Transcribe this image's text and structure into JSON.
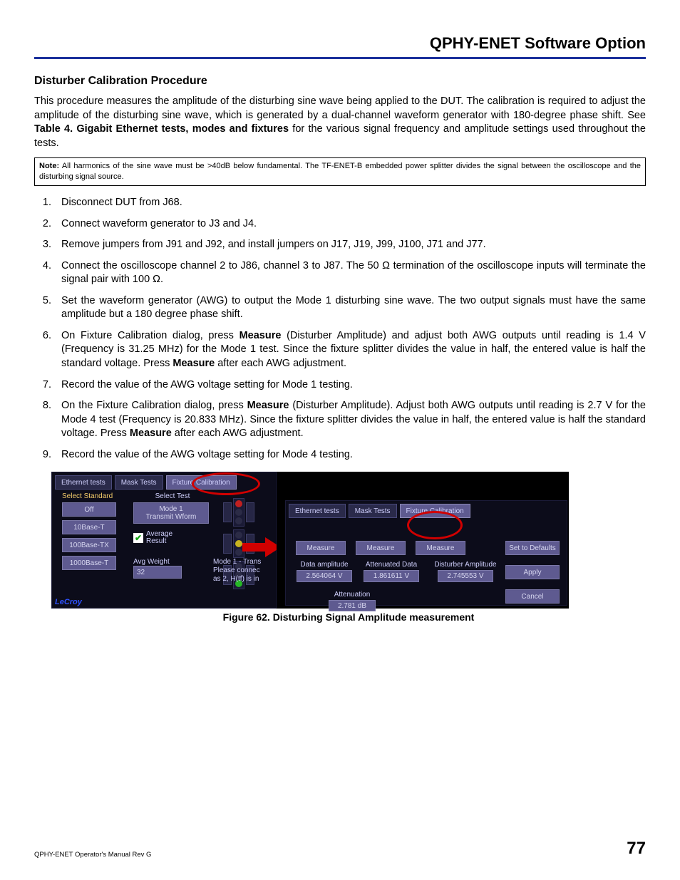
{
  "header": {
    "title": "QPHY-ENET Software Option"
  },
  "section": {
    "title": "Disturber Calibration Procedure"
  },
  "intro": {
    "p1a": "This procedure measures the amplitude of the disturbing sine wave being applied to the DUT. The calibration is required to adjust the amplitude of the disturbing sine wave, which is generated by a dual-channel waveform generator with 180-degree phase shift. See ",
    "p1b": "Table 4. Gigabit Ethernet tests, modes and fixtures",
    "p1c": " for the various signal frequency and amplitude settings used throughout the tests."
  },
  "note": {
    "label": "Note:",
    "text": " All harmonics of the sine wave must be >40dB below fundamental. The TF-ENET-B embedded power splitter divides the signal between the oscilloscope and the disturbing signal source."
  },
  "steps": {
    "s1": "Disconnect DUT from J68.",
    "s2": "Connect waveform generator to J3 and J4.",
    "s3": "Remove jumpers from J91 and J92, and install jumpers on J17, J19, J99, J100, J71 and J77.",
    "s4": "Connect the oscilloscope channel 2 to J86, channel 3 to J87. The 50 Ω termination of the oscilloscope inputs will terminate the signal pair with 100 Ω.",
    "s5": "Set the waveform generator (AWG) to output the Mode 1 disturbing sine wave. The two output signals must have the same amplitude but a 180 degree phase shift.",
    "s6a": "On Fixture Calibration dialog, press ",
    "s6b": "Measure",
    "s6c": " (Disturber Amplitude) and adjust both AWG outputs until reading is 1.4 V (Frequency is 31.25 MHz) for the Mode 1 test. Since the fixture splitter divides the value in half, the entered value is half the standard voltage. Press ",
    "s6d": "Measure",
    "s6e": " after each AWG adjustment.",
    "s7": "Record the value of the AWG voltage setting for Mode 1 testing.",
    "s8a": "On the Fixture Calibration dialog, press ",
    "s8b": "Measure",
    "s8c": " (Disturber Amplitude). Adjust both AWG outputs until reading is 2.7 V for the Mode 4 test (Frequency is 20.833 MHz). Since the fixture splitter divides the value in half, the entered value is half the standard voltage. Press ",
    "s8d": "Measure",
    "s8e": " after each AWG adjustment.",
    "s9": "Record the value of the AWG voltage setting for Mode 4 testing."
  },
  "figure": {
    "caption": "Figure 62. Disturbing Signal Amplitude measurement",
    "left": {
      "tabs": {
        "t1": "Ethernet tests",
        "t2": "Mask Tests",
        "t3": "Fixture Calibration"
      },
      "select_standard_label": "Select Standard",
      "standards": {
        "off": "Off",
        "b10": "10Base-T",
        "b100": "100Base-TX",
        "b1000": "1000Base-T"
      },
      "select_test_label": "Select Test",
      "mode1_btn": "Mode 1\nTransmit Wform",
      "avg_result": "Average\nResult",
      "avg_weight_label": "Avg Weight",
      "avg_weight_val": "32",
      "mode_hint": "Mode 1 - Trans\nPlease connec\nas 2, H(tf) is in",
      "brand": "LeCroy"
    },
    "right": {
      "tabs": {
        "t1": "Ethernet tests",
        "t2": "Mask Tests",
        "t3": "Fixture Calibration"
      },
      "measure": "Measure",
      "data_amp_label": "Data amplitude",
      "data_amp_val": "2.564064 V",
      "atten_data_label": "Attenuated Data",
      "atten_data_val": "1.861611 V",
      "dist_amp_label": "Disturber Amplitude",
      "dist_amp_val": "2.745553 V",
      "attenuation_label": "Attenuation",
      "attenuation_val": "2.781 dB",
      "defaults": "Set to Defaults",
      "apply": "Apply",
      "cancel": "Cancel"
    }
  },
  "footer": {
    "manual": "QPHY-ENET Operator's Manual Rev G",
    "page": "77"
  }
}
